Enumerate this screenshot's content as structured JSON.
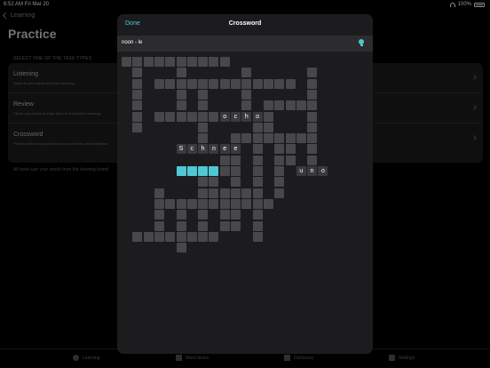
{
  "status_bar": {
    "time": "6:52 AM  Fri Mar 20",
    "battery": "100%"
  },
  "background": {
    "back_label": "Learning",
    "title": "Practice",
    "section_header": "SELECT ONE OF THE TASK TYPES",
    "rows": [
      {
        "label": "Listening",
        "desc": "Listen to your words with their meaning"
      },
      {
        "label": "Review",
        "desc": "Check your words and tap them to reveal their meaning"
      },
      {
        "label": "Crossword",
        "desc": "Practice with crossword that uses your terms and definitions"
      }
    ],
    "footnote": "All tasks use your words from the learning board"
  },
  "tabs": [
    {
      "label": "Learning",
      "icon": "checkmark-circle-icon"
    },
    {
      "label": "Word decks",
      "icon": "cards-icon"
    },
    {
      "label": "Dictionary",
      "icon": "book-icon"
    },
    {
      "label": "Settings",
      "icon": "sliders-icon"
    }
  ],
  "modal": {
    "done_label": "Done",
    "title": "Crossword",
    "clue": "noon - le",
    "hint_icon": "lightbulb-icon"
  },
  "crossword": {
    "words": [
      {
        "text": "ocho",
        "row": 5,
        "col": 9,
        "dir": "across"
      },
      {
        "text": "Schnee",
        "row": 8,
        "col": 5,
        "dir": "across"
      },
      {
        "text": "uno",
        "row": 10,
        "col": 16,
        "dir": "across"
      },
      {
        "text": "",
        "row": 10,
        "col": 5,
        "dir": "across",
        "length": 4,
        "active": true
      }
    ]
  },
  "colors": {
    "accent": "#4fc7d4",
    "cell": "#48484a",
    "modal_bg": "#1c1c1e"
  }
}
